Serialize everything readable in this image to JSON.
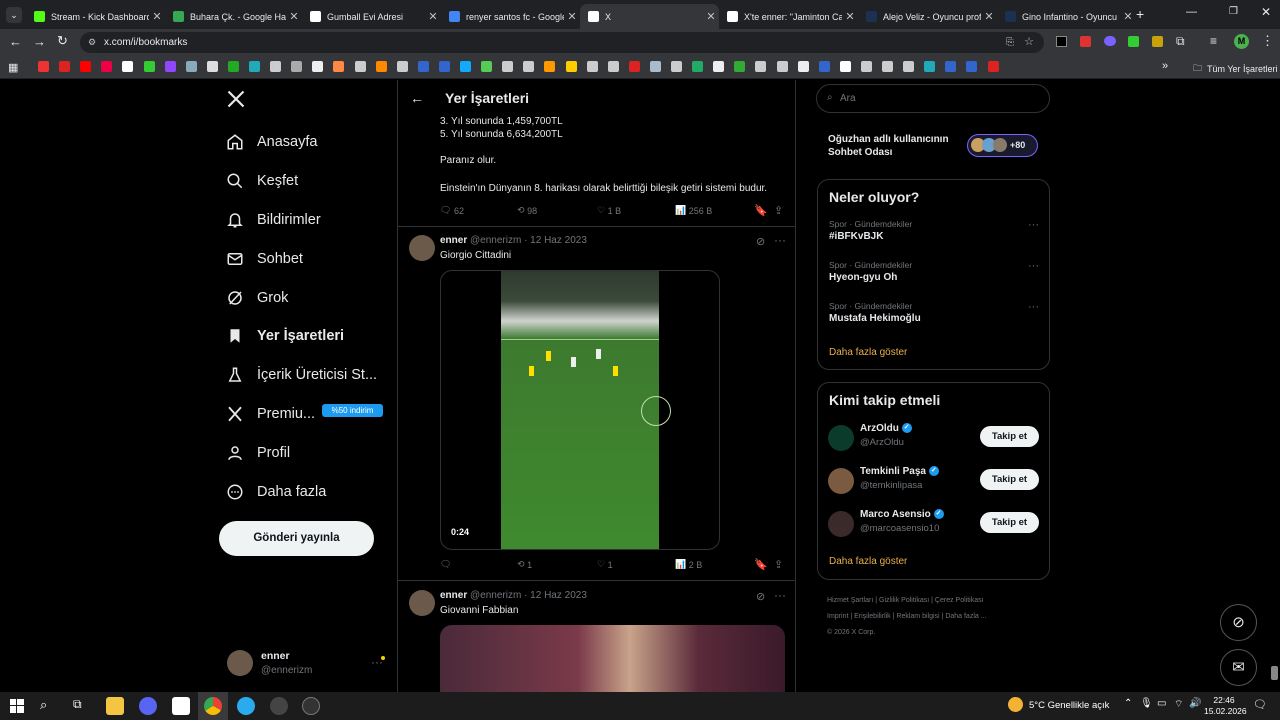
{
  "browser": {
    "tabs": [
      {
        "title": "Stream - Kick Dashboard",
        "favicon": "kick-icon",
        "color": "#53fc18",
        "active": false
      },
      {
        "title": "Buhara Çk. - Google Harit",
        "favicon": "maps-icon",
        "color": "#34a853",
        "active": false
      },
      {
        "title": "Gumball Evi Adresi",
        "favicon": "chatgpt-icon",
        "color": "#ffffff",
        "active": false
      },
      {
        "title": "renyer santos fc - Google",
        "favicon": "google-icon",
        "color": "#4285f4",
        "active": false
      },
      {
        "title": "X",
        "favicon": "x-icon",
        "color": "#ffffff",
        "active": true
      },
      {
        "title": "X'te enner: \"Jaminton Cam",
        "favicon": "x-icon",
        "color": "#ffffff",
        "active": false
      },
      {
        "title": "Alejo Veliz - Oyuncu profi",
        "favicon": "tm-icon",
        "color": "#1a3151",
        "active": false
      },
      {
        "title": "Gino Infantino - Oyuncu p",
        "favicon": "tm-icon",
        "color": "#1a3151",
        "active": false
      }
    ],
    "url": "x.com/i/bookmarks",
    "all_bookmarks": "Tüm Yer İşaretleri"
  },
  "sidebar": {
    "items": [
      {
        "label": "Anasayfa",
        "icon": "home-icon"
      },
      {
        "label": "Keşfet",
        "icon": "search-icon"
      },
      {
        "label": "Bildirimler",
        "icon": "bell-icon"
      },
      {
        "label": "Sohbet",
        "icon": "mail-icon"
      },
      {
        "label": "Grok",
        "icon": "grok-icon"
      },
      {
        "label": "Yer İşaretleri",
        "icon": "bookmark-icon"
      },
      {
        "label": "İçerik Üreticisi St...",
        "icon": "studio-icon"
      },
      {
        "label": "Premiu...",
        "icon": "x-logo-icon"
      },
      {
        "label": "Profil",
        "icon": "person-icon"
      },
      {
        "label": "Daha fazla",
        "icon": "more-circle-icon"
      }
    ],
    "premium_badge": "%50 indirim",
    "post_button": "Gönderi yayınla",
    "account": {
      "name": "enner",
      "handle": "@ennerizm"
    }
  },
  "header": {
    "title": "Yer İşaretleri"
  },
  "tweet0": {
    "lines": [
      "3. Yıl sonunda 1,459,700TL",
      "5. Yıl sonunda 6,634,200TL"
    ],
    "line2": "Paranız olur.",
    "line3": "Einstein'ın Dünyanın 8. harikası olarak belirttiği bileşik getiri sistemi budur.",
    "replies": "62",
    "reposts": "98",
    "likes": "1 B",
    "views": "256 B"
  },
  "tweet1": {
    "name": "enner",
    "handle": "@ennerizm",
    "date": "· 12 Haz 2023",
    "text": "Giorgio Cittadini",
    "duration": "0:24",
    "replies": "",
    "reposts": "1",
    "likes": "1",
    "views": "2 B"
  },
  "tweet2": {
    "name": "enner",
    "handle": "@ennerizm",
    "date": "· 12 Haz 2023",
    "text": "Giovanni Fabbian"
  },
  "right": {
    "search_placeholder": "Ara",
    "chatroom": "Oğuzhan adlı kullanıcının Sohbet Odası",
    "chatroom_count": "+80",
    "trends_title": "Neler oluyor?",
    "trends": [
      {
        "category": "Spor · Gündemdekiler",
        "name": "#iBFKvBJK"
      },
      {
        "category": "Spor · Gündemdekiler",
        "name": "Hyeon-gyu Oh"
      },
      {
        "category": "Spor · Gündemdekiler",
        "name": "Mustafa Hekimoğlu"
      }
    ],
    "show_more": "Daha fazla göster",
    "wtf_title": "Kimi takip etmeli",
    "who_to_follow": [
      {
        "name": "ArzOldu",
        "handle": "@ArzOldu"
      },
      {
        "name": "Temkinli Paşa",
        "handle": "@temkinlipasa"
      },
      {
        "name": "Marco Asensio",
        "handle": "@marcoasensio10"
      }
    ],
    "follow_label": "Takip et",
    "show_more2": "Daha fazla göster",
    "footer": [
      "Hizmet Şartları",
      "Gizlilik Politikası",
      "Çerez Politikası",
      "Imprint",
      "Erişilebilirlik",
      "Reklam bilgisi",
      "Daha fazla ...",
      "© 2026 X Corp."
    ]
  },
  "taskbar": {
    "weather": "5°C  Genellikle açık",
    "time": "22:46",
    "date": "15.02.2026"
  }
}
